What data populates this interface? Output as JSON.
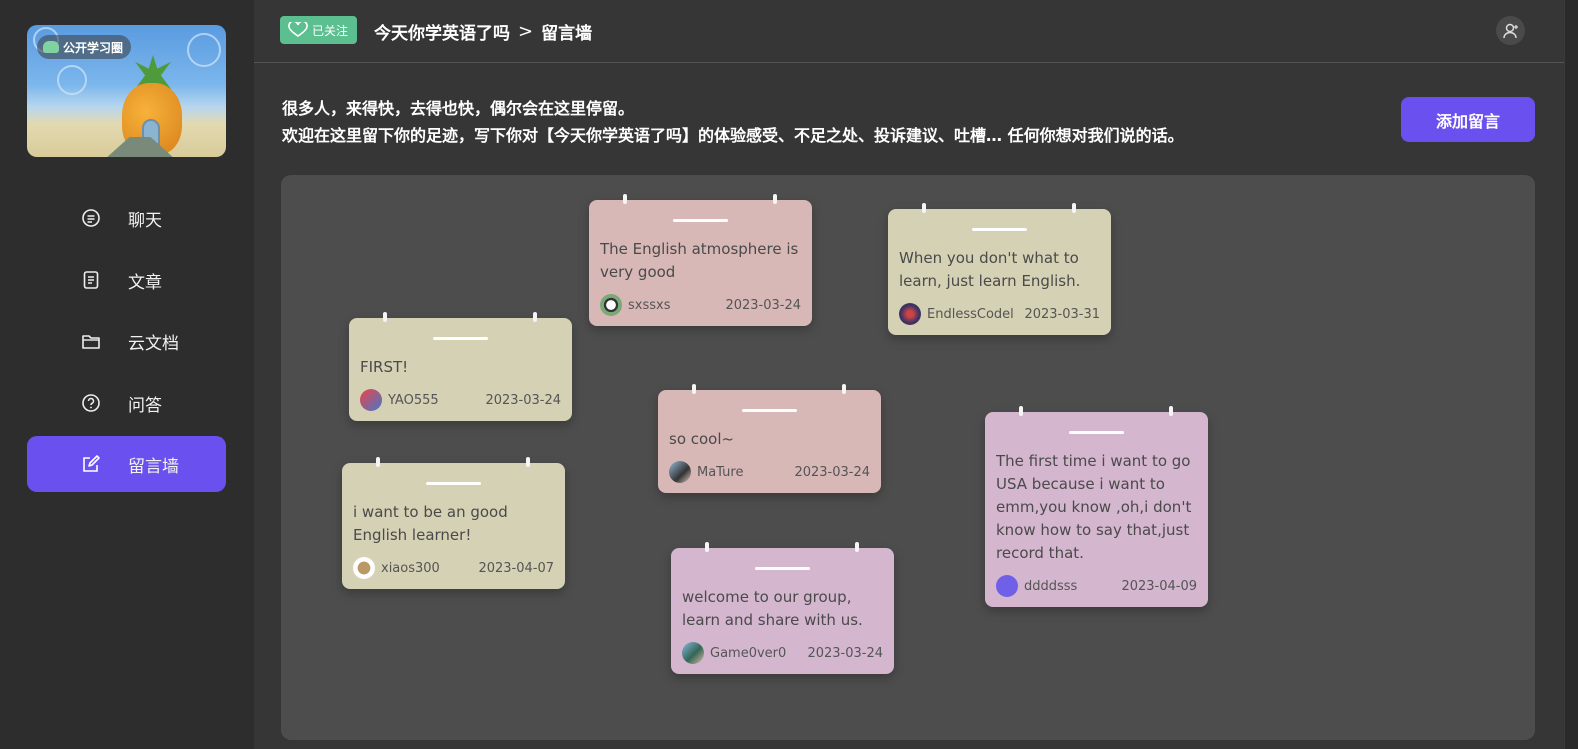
{
  "sidebar": {
    "cover_label": "公开学习圈",
    "items": [
      {
        "label": "聊天",
        "icon": "chat-icon"
      },
      {
        "label": "文章",
        "icon": "article-icon"
      },
      {
        "label": "云文档",
        "icon": "folder-icon"
      },
      {
        "label": "问答",
        "icon": "question-icon"
      },
      {
        "label": "留言墙",
        "icon": "edit-icon",
        "active": true
      }
    ]
  },
  "header": {
    "follow_label": "已关注",
    "breadcrumb": [
      "今天你学英语了吗",
      "留言墙"
    ],
    "breadcrumb_sep": ">"
  },
  "intro": {
    "line1": "很多人，来得快，去得也快，偶尔会在这里停留。",
    "line2": "欢迎在这里留下你的足迹，写下你对【今天你学英语了吗】的体验感受、不足之处、投诉建议、吐槽… 任何你想对我们说的话。"
  },
  "add_button": "添加留言",
  "colors": {
    "accent": "#6a50ef",
    "follow": "#5cbf8f",
    "note_yellow": "#d4d1b4",
    "note_pink": "#d8b7b7",
    "note_lilac": "#d4b6cf"
  },
  "notes": [
    {
      "text": "The English atmosphere is very good",
      "user": "sxssxs",
      "date": "2023-03-24"
    },
    {
      "text": "When you don't what to learn, just learn English.",
      "user": "EndlessCodel",
      "date": "2023-03-31"
    },
    {
      "text": "FIRST!",
      "user": "YAO555",
      "date": "2023-03-24"
    },
    {
      "text": "so cool~",
      "user": "MaTure",
      "date": "2023-03-24"
    },
    {
      "text": "The first time i want to go USA because i want to emm,you know ,oh,i don't know how to say that,just record that.",
      "user": "ddddsss",
      "date": "2023-04-09"
    },
    {
      "text": "i want to be an good English learner!",
      "user": "xiaos300",
      "date": "2023-04-07"
    },
    {
      "text": "welcome to our group, learn and share with us.",
      "user": "Game0ver0",
      "date": "2023-03-24"
    }
  ]
}
